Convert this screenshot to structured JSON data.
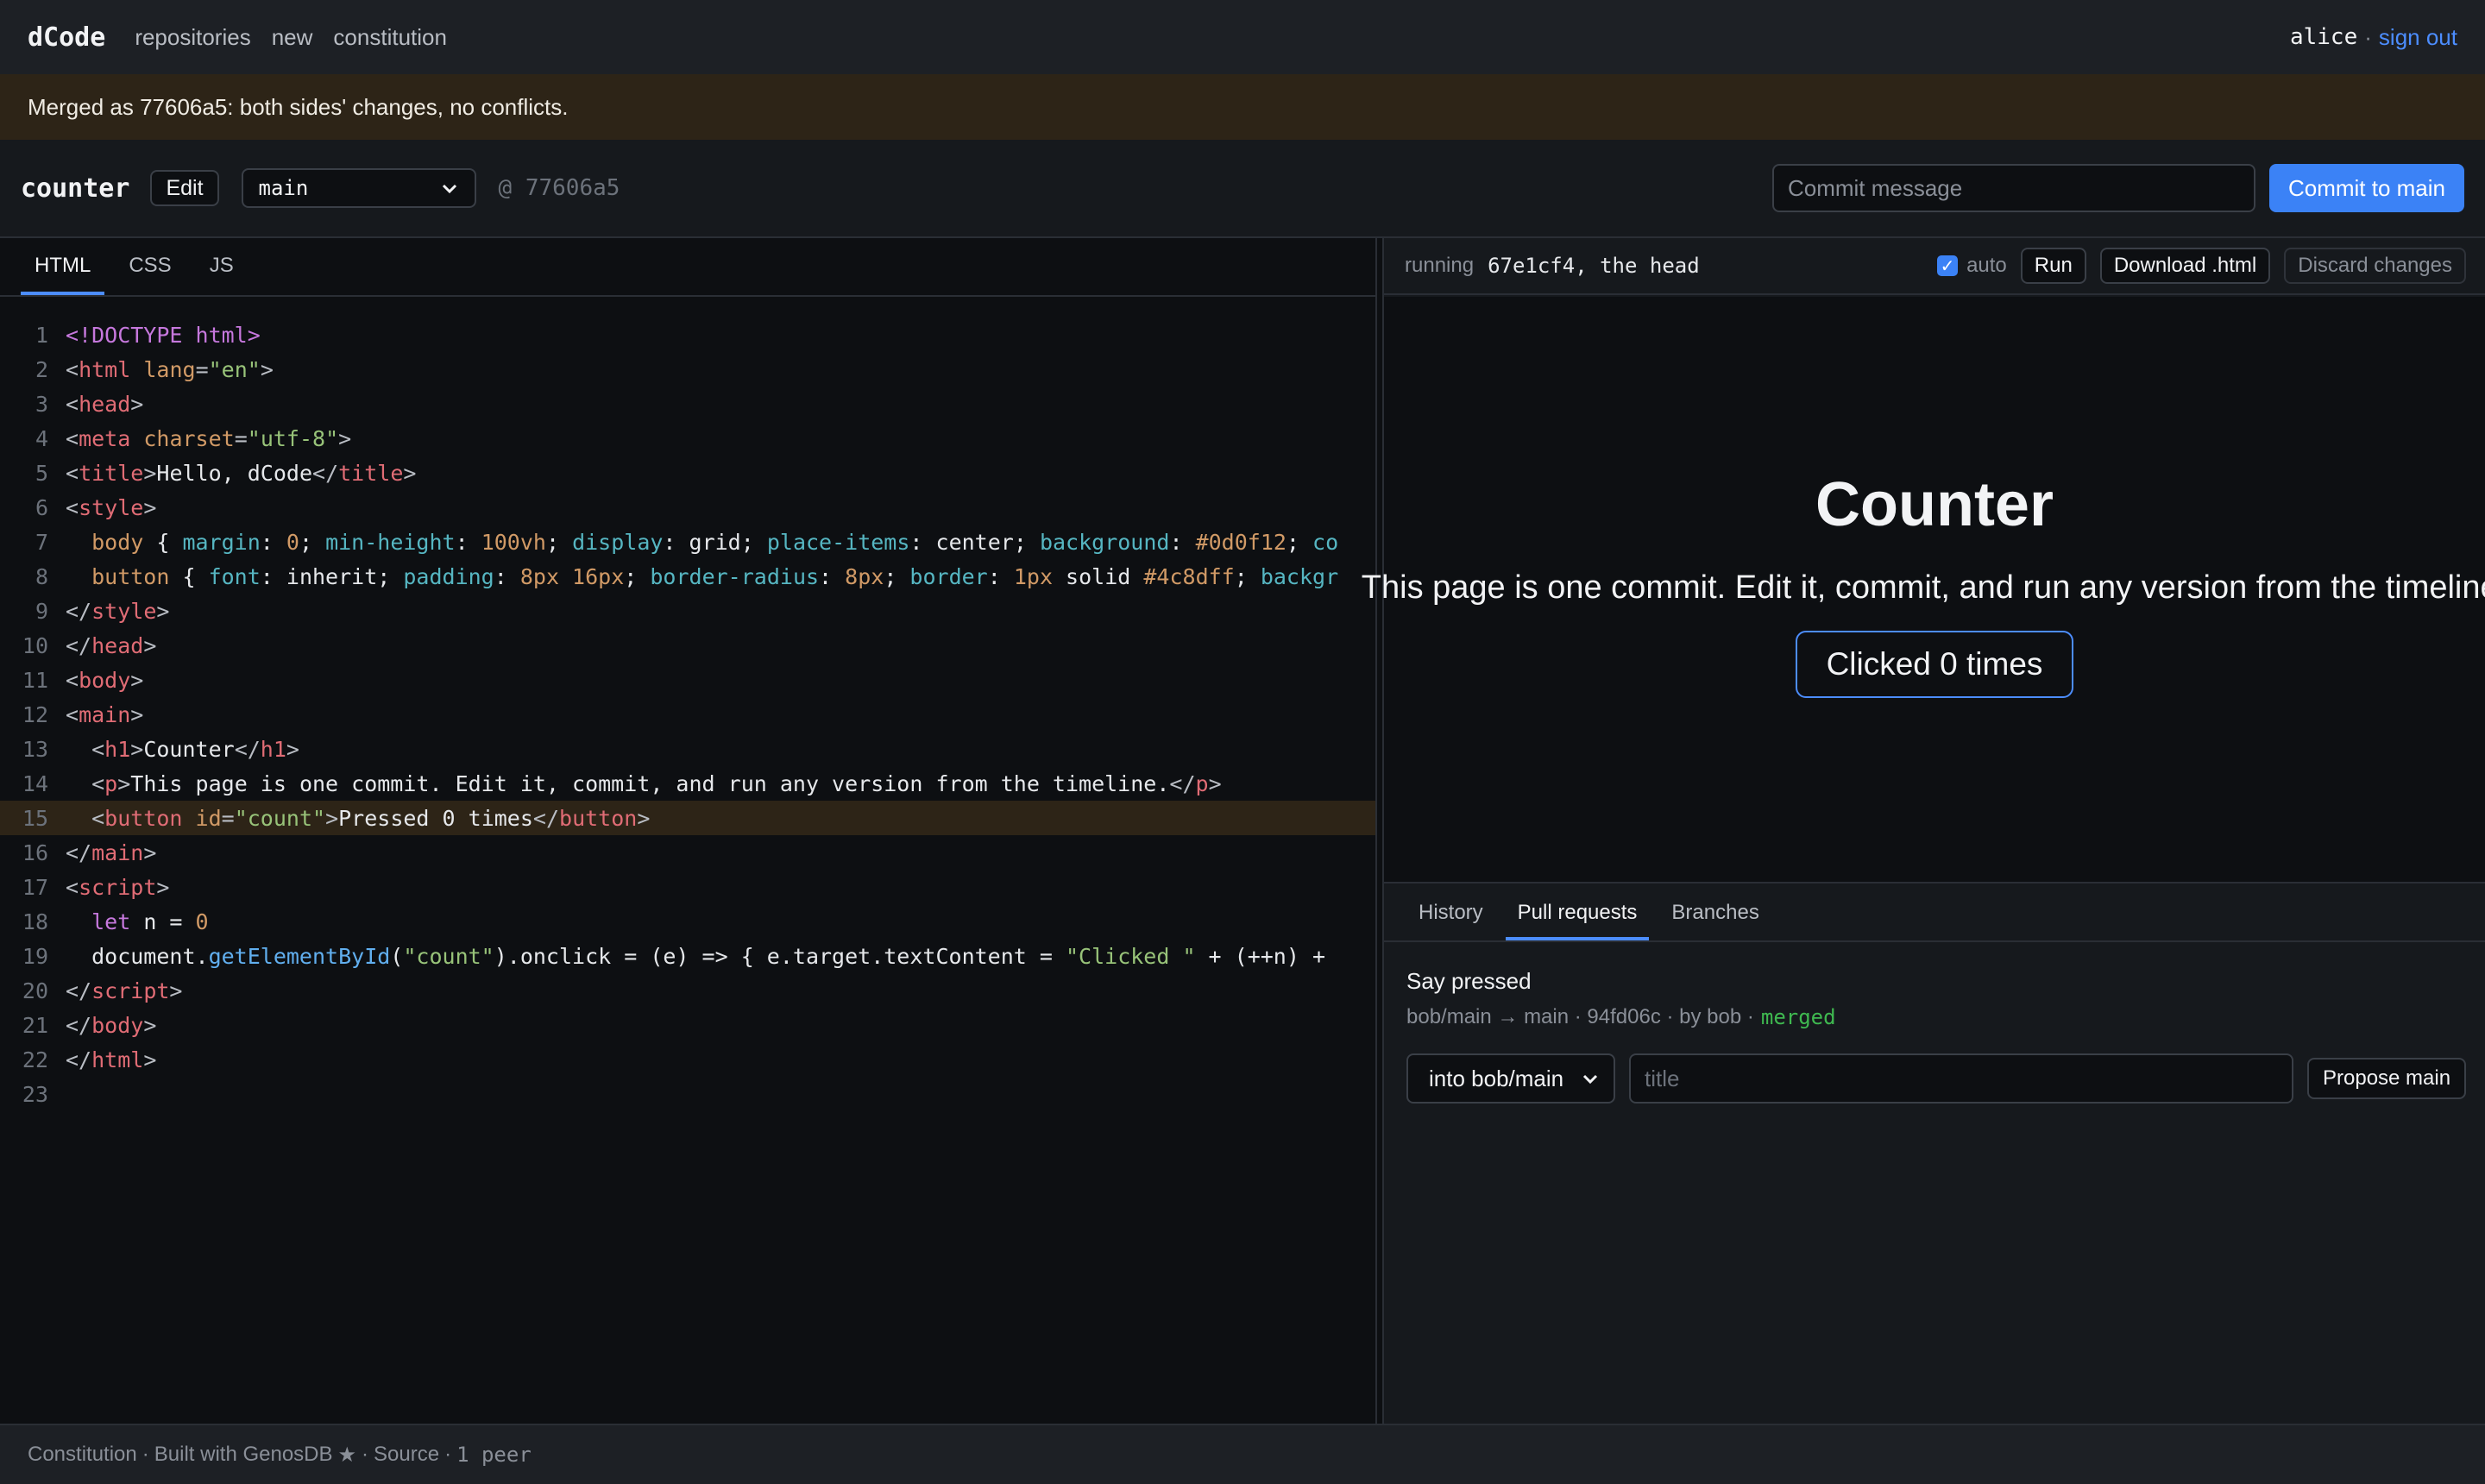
{
  "nav": {
    "logo": "dCode",
    "links": [
      "repositories",
      "new",
      "constitution"
    ],
    "username": "alice",
    "separator": "·",
    "signout": "sign out"
  },
  "banner": {
    "text": "Merged as 77606a5: both sides' changes, no conflicts."
  },
  "toolbar": {
    "repo": "counter",
    "edit": "Edit",
    "branch": "main",
    "commit_ref": "@ 77606a5",
    "commit_placeholder": "Commit message",
    "commit_button": "Commit to main"
  },
  "editor": {
    "tabs": [
      "HTML",
      "CSS",
      "JS"
    ],
    "active_tab": "HTML",
    "highlighted_line": 15,
    "lines": [
      "1",
      "2",
      "3",
      "4",
      "5",
      "6",
      "7",
      "8",
      "9",
      "10",
      "11",
      "12",
      "13",
      "14",
      "15",
      "16",
      "17",
      "18",
      "19",
      "20",
      "21",
      "22",
      "23"
    ],
    "code": {
      "l1": [
        "<!DOCTYPE html>"
      ],
      "l2": [
        "<",
        "html",
        " ",
        "lang",
        "=",
        "\"en\"",
        ">"
      ],
      "l3": [
        "<",
        "head",
        ">"
      ],
      "l4": [
        "<",
        "meta",
        " ",
        "charset",
        "=",
        "\"utf-8\"",
        ">"
      ],
      "l5": [
        "<",
        "title",
        ">",
        "Hello, dCode",
        "</",
        "title",
        ">"
      ],
      "l6": [
        "<",
        "style",
        ">"
      ],
      "l7": [
        "  body",
        " { ",
        "margin",
        ": ",
        "0",
        "; ",
        "min-height",
        ": ",
        "100vh",
        "; ",
        "display",
        ": grid; ",
        "place-items",
        ": center; ",
        "background",
        ": ",
        "#0d0f12",
        "; ",
        "co"
      ],
      "l8": [
        "  button",
        " { ",
        "font",
        ": inherit; ",
        "padding",
        ": ",
        "8px 16px",
        "; ",
        "border-radius",
        ": ",
        "8px",
        "; ",
        "border",
        ": ",
        "1px",
        " solid ",
        "#4c8dff",
        "; ",
        "backgr"
      ],
      "l9": [
        "</",
        "style",
        ">"
      ],
      "l10": [
        "</",
        "head",
        ">"
      ],
      "l11": [
        "<",
        "body",
        ">"
      ],
      "l12": [
        "<",
        "main",
        ">"
      ],
      "l13": [
        "  <",
        "h1",
        ">",
        "Counter",
        "</",
        "h1",
        ">"
      ],
      "l14": [
        "  <",
        "p",
        ">",
        "This page is one commit. Edit it, commit, and run any version from the timeline.",
        "</",
        "p",
        ">"
      ],
      "l15": [
        "  <",
        "button",
        " ",
        "id",
        "=",
        "\"count\"",
        ">",
        "Pressed 0 times",
        "</",
        "button",
        ">"
      ],
      "l16": [
        "</",
        "main",
        ">"
      ],
      "l17": [
        "<",
        "script",
        ">"
      ],
      "l18": [
        "  ",
        "let",
        " n = ",
        "0"
      ],
      "l19": [
        "  document.",
        "getElementById",
        "(",
        "\"count\"",
        ").onclick = (e) => { e.target.textContent = ",
        "\"Clicked \"",
        " + (++n) +"
      ],
      "l20": [
        "</",
        "script",
        ">"
      ],
      "l21": [
        "</",
        "body",
        ">"
      ],
      "l22": [
        "</",
        "html",
        ">"
      ]
    }
  },
  "preview": {
    "running_label": "running",
    "running_ref": "67e1cf4, the head",
    "auto_label": "auto",
    "auto_checked": true,
    "run_button": "Run",
    "download_button": "Download .html",
    "discard_button": "Discard changes",
    "frame": {
      "heading": "Counter",
      "paragraph": "This page is one commit. Edit it, commit, and run any version from the timeline.",
      "button": "Clicked 0 times"
    }
  },
  "lower": {
    "tabs": [
      "History",
      "Pull requests",
      "Branches"
    ],
    "active_tab": "Pull requests",
    "pr": {
      "title": "Say pressed",
      "meta": "bob/main → main · 94fd06c · by bob ·",
      "status": "merged"
    },
    "into_select": "into bob/main",
    "title_placeholder": "title",
    "propose_button": "Propose main"
  },
  "footer": {
    "constitution": "Constitution",
    "dot1": "·",
    "built_with": "Built with GenosDB",
    "star": "★",
    "dot2": "·",
    "source": "Source",
    "dot3": "·",
    "peers": "1 peer"
  },
  "colors": {
    "accent": "#4c8dff",
    "commit_button": "#3b82f6",
    "banner_bg": "#2d2417",
    "merged": "#3fb950"
  }
}
